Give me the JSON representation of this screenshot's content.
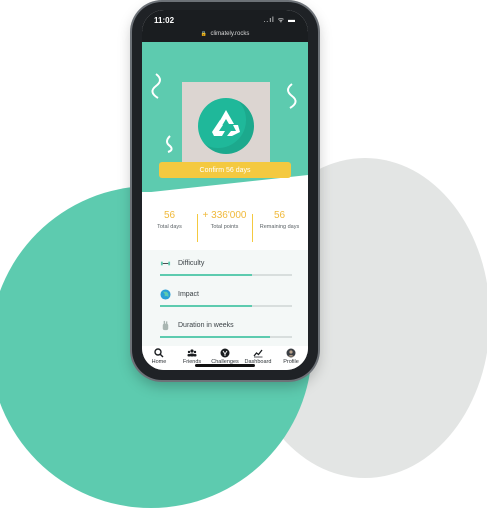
{
  "status": {
    "time": "11:02",
    "icons": "..ıl ᯤ ▬"
  },
  "browser": {
    "url": "climately.rocks"
  },
  "hero": {
    "confirm_label": "Confirm 56 days",
    "illustration_icon": "recycle-icon"
  },
  "stats": [
    {
      "value": "56",
      "label": "Total days"
    },
    {
      "value": "+ 336'000",
      "label": "Total points"
    },
    {
      "value": "56",
      "label": "Remaining days"
    }
  ],
  "metrics": [
    {
      "label": "Difficulty",
      "icon": "dumbbell-icon",
      "level": 0.7
    },
    {
      "label": "Impact",
      "icon": "globe-icon",
      "level": 0.7
    },
    {
      "label": "Duration in weeks",
      "icon": "hand-icon",
      "level": 0.83
    }
  ],
  "tabs": [
    {
      "label": "Home",
      "icon": "search-icon"
    },
    {
      "label": "Friends",
      "icon": "friends-icon"
    },
    {
      "label": "Challenges",
      "icon": "challenges-icon"
    },
    {
      "label": "Dashboard",
      "icon": "chart-icon"
    },
    {
      "label": "Profile",
      "icon": "profile-icon"
    }
  ],
  "colors": {
    "accent": "#5dcbaf",
    "highlight": "#f4c940",
    "dark": "#1a1d20",
    "grey": "#e3e5e4"
  }
}
